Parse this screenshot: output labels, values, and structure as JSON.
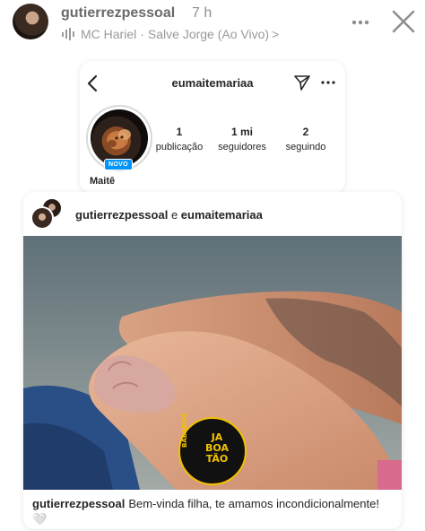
{
  "story": {
    "username": "gutierrezpessoal",
    "time": "7 h",
    "music": {
      "icon": "music-bars-icon",
      "artist": "MC Hariel",
      "separator": "·",
      "song": "Salve Jorge (Ao Vivo)",
      "chevron": ">"
    },
    "more_icon": "more-horizontal-icon",
    "close_icon": "close-icon"
  },
  "profile_card": {
    "username": "eumaitemariaa",
    "badge": "NOVO",
    "name": "Maitê",
    "stats": [
      {
        "value": "1",
        "label": "publicação"
      },
      {
        "value": "1 mi",
        "label": "seguidores"
      },
      {
        "value": "2",
        "label": "seguindo"
      }
    ],
    "icons": {
      "back": "chevron-left-icon",
      "send": "send-icon",
      "more": "more-horizontal-icon"
    }
  },
  "post_card": {
    "author_1": "gutierrezpessoal",
    "conjunction": " e ",
    "author_2": "eumaitemariaa",
    "image_logo": {
      "line_1": "JA",
      "line_2": "BOA",
      "line_3": "TÃO",
      "side": "BABADOS"
    },
    "caption_user": "gutierrezpessoal",
    "caption_text": "Bem-vinda filha, te amamos incondicionalmente! 🤍"
  },
  "colors": {
    "accent_blue": "#0095f6",
    "logo_yellow": "#f2c200",
    "logo_black": "#111111"
  }
}
